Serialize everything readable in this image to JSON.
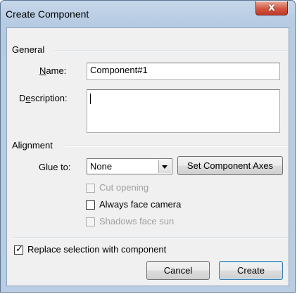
{
  "window": {
    "title": "Create Component",
    "close_glyph": "x"
  },
  "general": {
    "group_label": "General",
    "name_label_pre": "",
    "name_label_accel": "N",
    "name_label_post": "ame:",
    "name_value": "Component#1",
    "description_label_pre": "D",
    "description_label_accel": "e",
    "description_label_post": "scription:",
    "description_value": ""
  },
  "alignment": {
    "group_label": "Alignment",
    "glue_label": "Glue to:",
    "glue_value": "None",
    "set_axes_button": "Set Component Axes",
    "cut_opening": {
      "label": "Cut opening",
      "checked": false,
      "enabled": false
    },
    "always_face_camera": {
      "label": "Always face camera",
      "checked": false,
      "enabled": true
    },
    "shadows_face_sun": {
      "label": "Shadows face sun",
      "checked": false,
      "enabled": false
    }
  },
  "footer": {
    "replace_selection": {
      "label": "Replace selection with component",
      "checked": true
    },
    "cancel_button": "Cancel",
    "create_button": "Create"
  },
  "colors": {
    "frame": "#b9cde4",
    "client": "#f0f0f0",
    "close_button": "#c0392b"
  }
}
